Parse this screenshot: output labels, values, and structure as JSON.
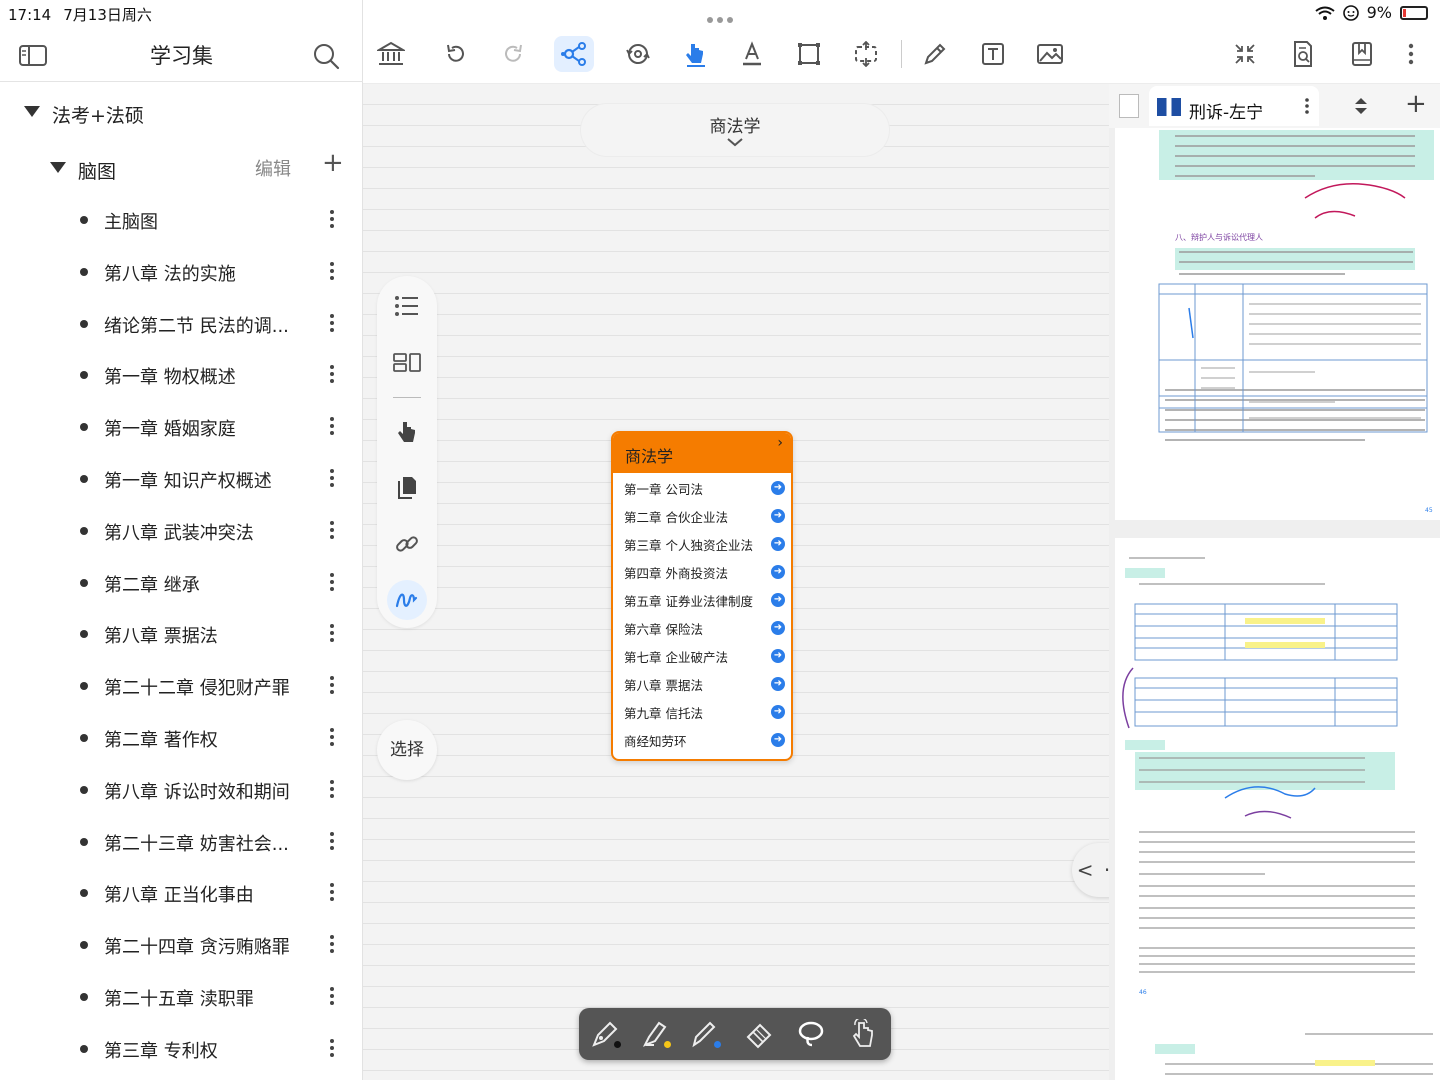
{
  "status": {
    "time": "17:14",
    "date": "7月13日周六",
    "battery": "9%"
  },
  "sidebar": {
    "title": "学习集",
    "root_group": "法考+法硕",
    "sub_group": "脑图",
    "edit_label": "编辑",
    "add_label": "+",
    "items": [
      {
        "label": "主脑图"
      },
      {
        "label": "第八章 法的实施"
      },
      {
        "label": "绪论第二节 民法的调..."
      },
      {
        "label": "第一章 物权概述"
      },
      {
        "label": "第一章 婚姻家庭"
      },
      {
        "label": "第一章 知识产权概述"
      },
      {
        "label": "第八章 武装冲突法"
      },
      {
        "label": "第二章 继承"
      },
      {
        "label": "第八章 票据法"
      },
      {
        "label": "第二十二章 侵犯财产罪"
      },
      {
        "label": "第二章 著作权"
      },
      {
        "label": "第八章 诉讼时效和期间"
      },
      {
        "label": "第二十三章 妨害社会..."
      },
      {
        "label": "第八章 正当化事由"
      },
      {
        "label": "第二十四章 贪污贿赂罪"
      },
      {
        "label": "第二十五章 渎职罪"
      },
      {
        "label": "第三章 专利权"
      }
    ]
  },
  "toolbar": {
    "active_tool": "mindmap-icon",
    "accent": "#2b7de9"
  },
  "canvas": {
    "doc_title": "商法学",
    "select_label": "选择",
    "mindmap": {
      "title": "商法学",
      "head_color": "#f57c00",
      "rows": [
        "第一章 公司法",
        "第二章 合伙企业法",
        "第三章 个人独资企业法",
        "第四章 外商投资法",
        "第五章 证券业法律制度",
        "第六章 保险法",
        "第七章 企业破产法",
        "第八章 票据法",
        "第九章 信托法",
        "商经知劳环"
      ]
    },
    "nav_label": "< · >"
  },
  "pdf": {
    "tab_title": "刑诉-左宁"
  }
}
